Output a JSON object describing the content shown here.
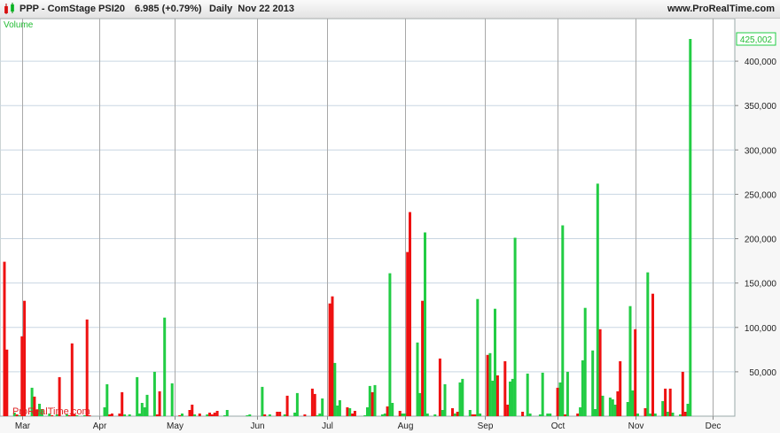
{
  "header": {
    "symbol": "PPP - ComStage PSI20",
    "price": "6.985 (+0.79%)",
    "period": "Daily",
    "date": "Nov 22 2013",
    "source": "www.ProRealTime.com"
  },
  "chart_data": {
    "type": "bar",
    "title": "Volume",
    "watermark": "ProRealTime.com",
    "last_value_label": "425,002",
    "x_start": "2013-02-21",
    "x_end": "2013-12-08",
    "month_labels": [
      {
        "label": "Mar",
        "date": "2013-03-01"
      },
      {
        "label": "Apr",
        "date": "2013-04-01"
      },
      {
        "label": "May",
        "date": "2013-05-01"
      },
      {
        "label": "Jun",
        "date": "2013-06-03"
      },
      {
        "label": "Jul",
        "date": "2013-07-01"
      },
      {
        "label": "Aug",
        "date": "2013-08-01"
      },
      {
        "label": "Sep",
        "date": "2013-09-02"
      },
      {
        "label": "Oct",
        "date": "2013-10-01"
      },
      {
        "label": "Nov",
        "date": "2013-11-01"
      },
      {
        "label": "Dec",
        "date": "2013-12-02"
      }
    ],
    "ylim": [
      0,
      440000
    ],
    "yticks": [
      50000,
      100000,
      150000,
      200000,
      250000,
      300000,
      350000,
      400000
    ],
    "ytick_labels": [
      "50,000",
      "100,000",
      "150,000",
      "200,000",
      "250,000",
      "300,000",
      "350,000",
      "400,000"
    ],
    "grid": true,
    "colors": {
      "up": "#22cc44",
      "down": "#ee1111",
      "grid": "#c9d6e2",
      "month_line": "#a8a8a8"
    },
    "bars": [
      {
        "x": "2013-02-21",
        "y": 174000,
        "c": "d"
      },
      {
        "x": "2013-02-22",
        "y": 75000,
        "c": "d"
      },
      {
        "x": "2013-02-25",
        "y": 4000,
        "c": "u"
      },
      {
        "x": "2013-02-26",
        "y": 2000,
        "c": "d"
      },
      {
        "x": "2013-02-27",
        "y": 1000,
        "c": "u"
      },
      {
        "x": "2013-02-28",
        "y": 90000,
        "c": "d"
      },
      {
        "x": "2013-03-01",
        "y": 130000,
        "c": "d"
      },
      {
        "x": "2013-03-04",
        "y": 32000,
        "c": "u"
      },
      {
        "x": "2013-03-05",
        "y": 22000,
        "c": "d"
      },
      {
        "x": "2013-03-06",
        "y": 7000,
        "c": "d"
      },
      {
        "x": "2013-03-07",
        "y": 14000,
        "c": "u"
      },
      {
        "x": "2013-03-08",
        "y": 8000,
        "c": "u"
      },
      {
        "x": "2013-03-11",
        "y": 3000,
        "c": "u"
      },
      {
        "x": "2013-03-12",
        "y": 1000,
        "c": "d"
      },
      {
        "x": "2013-03-14",
        "y": 2000,
        "c": "u"
      },
      {
        "x": "2013-03-15",
        "y": 44000,
        "c": "d"
      },
      {
        "x": "2013-03-18",
        "y": 2000,
        "c": "u"
      },
      {
        "x": "2013-03-19",
        "y": 1000,
        "c": "d"
      },
      {
        "x": "2013-03-20",
        "y": 82000,
        "c": "d"
      },
      {
        "x": "2013-03-21",
        "y": 2000,
        "c": "d"
      },
      {
        "x": "2013-03-22",
        "y": 1000,
        "c": "u"
      },
      {
        "x": "2013-03-25",
        "y": 1000,
        "c": "u"
      },
      {
        "x": "2013-03-26",
        "y": 109000,
        "c": "d"
      },
      {
        "x": "2013-03-27",
        "y": 1000,
        "c": "d"
      },
      {
        "x": "2013-04-02",
        "y": 10000,
        "c": "u"
      },
      {
        "x": "2013-04-03",
        "y": 36000,
        "c": "u"
      },
      {
        "x": "2013-04-04",
        "y": 2000,
        "c": "d"
      },
      {
        "x": "2013-04-05",
        "y": 3000,
        "c": "d"
      },
      {
        "x": "2013-04-08",
        "y": 3000,
        "c": "d"
      },
      {
        "x": "2013-04-09",
        "y": 27000,
        "c": "d"
      },
      {
        "x": "2013-04-10",
        "y": 2000,
        "c": "u"
      },
      {
        "x": "2013-04-12",
        "y": 2000,
        "c": "u"
      },
      {
        "x": "2013-04-15",
        "y": 44000,
        "c": "u"
      },
      {
        "x": "2013-04-16",
        "y": 3000,
        "c": "u"
      },
      {
        "x": "2013-04-17",
        "y": 15000,
        "c": "u"
      },
      {
        "x": "2013-04-18",
        "y": 10000,
        "c": "u"
      },
      {
        "x": "2013-04-19",
        "y": 24000,
        "c": "u"
      },
      {
        "x": "2013-04-22",
        "y": 50000,
        "c": "u"
      },
      {
        "x": "2013-04-23",
        "y": 2000,
        "c": "d"
      },
      {
        "x": "2013-04-24",
        "y": 28000,
        "c": "d"
      },
      {
        "x": "2013-04-26",
        "y": 111000,
        "c": "u"
      },
      {
        "x": "2013-04-29",
        "y": 37000,
        "c": "u"
      },
      {
        "x": "2013-05-02",
        "y": 1000,
        "c": "d"
      },
      {
        "x": "2013-05-03",
        "y": 3000,
        "c": "u"
      },
      {
        "x": "2013-05-06",
        "y": 7000,
        "c": "d"
      },
      {
        "x": "2013-05-07",
        "y": 13000,
        "c": "d"
      },
      {
        "x": "2013-05-08",
        "y": 2000,
        "c": "u"
      },
      {
        "x": "2013-05-10",
        "y": 3000,
        "c": "d"
      },
      {
        "x": "2013-05-13",
        "y": 2000,
        "c": "u"
      },
      {
        "x": "2013-05-14",
        "y": 4000,
        "c": "d"
      },
      {
        "x": "2013-05-15",
        "y": 2000,
        "c": "d"
      },
      {
        "x": "2013-05-16",
        "y": 4000,
        "c": "d"
      },
      {
        "x": "2013-05-17",
        "y": 6000,
        "c": "d"
      },
      {
        "x": "2013-05-20",
        "y": 1000,
        "c": "u"
      },
      {
        "x": "2013-05-21",
        "y": 7000,
        "c": "u"
      },
      {
        "x": "2013-05-29",
        "y": 1000,
        "c": "u"
      },
      {
        "x": "2013-05-30",
        "y": 2000,
        "c": "u"
      },
      {
        "x": "2013-06-04",
        "y": 33000,
        "c": "u"
      },
      {
        "x": "2013-06-05",
        "y": 2000,
        "c": "d"
      },
      {
        "x": "2013-06-07",
        "y": 2000,
        "c": "u"
      },
      {
        "x": "2013-06-10",
        "y": 5000,
        "c": "d"
      },
      {
        "x": "2013-06-11",
        "y": 5000,
        "c": "d"
      },
      {
        "x": "2013-06-13",
        "y": 2000,
        "c": "u"
      },
      {
        "x": "2013-06-14",
        "y": 23000,
        "c": "d"
      },
      {
        "x": "2013-06-17",
        "y": 4000,
        "c": "u"
      },
      {
        "x": "2013-06-18",
        "y": 26000,
        "c": "u"
      },
      {
        "x": "2013-06-21",
        "y": 2000,
        "c": "d"
      },
      {
        "x": "2013-06-24",
        "y": 31000,
        "c": "d"
      },
      {
        "x": "2013-06-25",
        "y": 25000,
        "c": "d"
      },
      {
        "x": "2013-06-26",
        "y": 1000,
        "c": "u"
      },
      {
        "x": "2013-06-27",
        "y": 3000,
        "c": "u"
      },
      {
        "x": "2013-06-28",
        "y": 20000,
        "c": "u"
      },
      {
        "x": "2013-07-01",
        "y": 127000,
        "c": "d"
      },
      {
        "x": "2013-07-02",
        "y": 135000,
        "c": "d"
      },
      {
        "x": "2013-07-03",
        "y": 60000,
        "c": "u"
      },
      {
        "x": "2013-07-04",
        "y": 12000,
        "c": "u"
      },
      {
        "x": "2013-07-05",
        "y": 18000,
        "c": "u"
      },
      {
        "x": "2013-07-08",
        "y": 10000,
        "c": "d"
      },
      {
        "x": "2013-07-09",
        "y": 9000,
        "c": "u"
      },
      {
        "x": "2013-07-10",
        "y": 3000,
        "c": "d"
      },
      {
        "x": "2013-07-11",
        "y": 6000,
        "c": "d"
      },
      {
        "x": "2013-07-15",
        "y": 1000,
        "c": "u"
      },
      {
        "x": "2013-07-16",
        "y": 10000,
        "c": "u"
      },
      {
        "x": "2013-07-17",
        "y": 34000,
        "c": "u"
      },
      {
        "x": "2013-07-18",
        "y": 27000,
        "c": "d"
      },
      {
        "x": "2013-07-19",
        "y": 35000,
        "c": "u"
      },
      {
        "x": "2013-07-22",
        "y": 2000,
        "c": "u"
      },
      {
        "x": "2013-07-23",
        "y": 3000,
        "c": "u"
      },
      {
        "x": "2013-07-24",
        "y": 11000,
        "c": "d"
      },
      {
        "x": "2013-07-25",
        "y": 161000,
        "c": "u"
      },
      {
        "x": "2013-07-26",
        "y": 15000,
        "c": "u"
      },
      {
        "x": "2013-07-29",
        "y": 6000,
        "c": "d"
      },
      {
        "x": "2013-07-30",
        "y": 3000,
        "c": "u"
      },
      {
        "x": "2013-07-31",
        "y": 3000,
        "c": "u"
      },
      {
        "x": "2013-08-01",
        "y": 185000,
        "c": "d"
      },
      {
        "x": "2013-08-02",
        "y": 230000,
        "c": "d"
      },
      {
        "x": "2013-08-05",
        "y": 83000,
        "c": "u"
      },
      {
        "x": "2013-08-06",
        "y": 26000,
        "c": "u"
      },
      {
        "x": "2013-08-07",
        "y": 130000,
        "c": "d"
      },
      {
        "x": "2013-08-08",
        "y": 207000,
        "c": "u"
      },
      {
        "x": "2013-08-09",
        "y": 3000,
        "c": "u"
      },
      {
        "x": "2013-08-12",
        "y": 2000,
        "c": "u"
      },
      {
        "x": "2013-08-14",
        "y": 65000,
        "c": "d"
      },
      {
        "x": "2013-08-15",
        "y": 7000,
        "c": "u"
      },
      {
        "x": "2013-08-16",
        "y": 36000,
        "c": "u"
      },
      {
        "x": "2013-08-19",
        "y": 9000,
        "c": "d"
      },
      {
        "x": "2013-08-20",
        "y": 3000,
        "c": "u"
      },
      {
        "x": "2013-08-21",
        "y": 5000,
        "c": "d"
      },
      {
        "x": "2013-08-22",
        "y": 38000,
        "c": "u"
      },
      {
        "x": "2013-08-23",
        "y": 42000,
        "c": "u"
      },
      {
        "x": "2013-08-26",
        "y": 7000,
        "c": "u"
      },
      {
        "x": "2013-08-27",
        "y": 2000,
        "c": "d"
      },
      {
        "x": "2013-08-28",
        "y": 2000,
        "c": "d"
      },
      {
        "x": "2013-08-29",
        "y": 132000,
        "c": "u"
      },
      {
        "x": "2013-08-30",
        "y": 3000,
        "c": "u"
      },
      {
        "x": "2013-09-02",
        "y": 69000,
        "c": "d"
      },
      {
        "x": "2013-09-03",
        "y": 71000,
        "c": "u"
      },
      {
        "x": "2013-09-04",
        "y": 40000,
        "c": "u"
      },
      {
        "x": "2013-09-05",
        "y": 121000,
        "c": "u"
      },
      {
        "x": "2013-09-06",
        "y": 46000,
        "c": "d"
      },
      {
        "x": "2013-09-09",
        "y": 62000,
        "c": "d"
      },
      {
        "x": "2013-09-10",
        "y": 13000,
        "c": "d"
      },
      {
        "x": "2013-09-11",
        "y": 39000,
        "c": "u"
      },
      {
        "x": "2013-09-12",
        "y": 42000,
        "c": "u"
      },
      {
        "x": "2013-09-13",
        "y": 201000,
        "c": "u"
      },
      {
        "x": "2013-09-16",
        "y": 5000,
        "c": "d"
      },
      {
        "x": "2013-09-18",
        "y": 48000,
        "c": "u"
      },
      {
        "x": "2013-09-19",
        "y": 3000,
        "c": "u"
      },
      {
        "x": "2013-09-23",
        "y": 2000,
        "c": "u"
      },
      {
        "x": "2013-09-24",
        "y": 49000,
        "c": "u"
      },
      {
        "x": "2013-09-26",
        "y": 3000,
        "c": "u"
      },
      {
        "x": "2013-09-27",
        "y": 3000,
        "c": "u"
      },
      {
        "x": "2013-09-30",
        "y": 32000,
        "c": "d"
      },
      {
        "x": "2013-10-01",
        "y": 38000,
        "c": "u"
      },
      {
        "x": "2013-10-02",
        "y": 215000,
        "c": "u"
      },
      {
        "x": "2013-10-03",
        "y": 2000,
        "c": "d"
      },
      {
        "x": "2013-10-04",
        "y": 50000,
        "c": "u"
      },
      {
        "x": "2013-10-08",
        "y": 3000,
        "c": "d"
      },
      {
        "x": "2013-10-09",
        "y": 10000,
        "c": "u"
      },
      {
        "x": "2013-10-10",
        "y": 63000,
        "c": "u"
      },
      {
        "x": "2013-10-11",
        "y": 122000,
        "c": "u"
      },
      {
        "x": "2013-10-14",
        "y": 74000,
        "c": "u"
      },
      {
        "x": "2013-10-15",
        "y": 8000,
        "c": "u"
      },
      {
        "x": "2013-10-16",
        "y": 262000,
        "c": "u"
      },
      {
        "x": "2013-10-17",
        "y": 98000,
        "c": "d"
      },
      {
        "x": "2013-10-18",
        "y": 23000,
        "c": "u"
      },
      {
        "x": "2013-10-21",
        "y": 21000,
        "c": "u"
      },
      {
        "x": "2013-10-22",
        "y": 19000,
        "c": "u"
      },
      {
        "x": "2013-10-23",
        "y": 13000,
        "c": "u"
      },
      {
        "x": "2013-10-24",
        "y": 28000,
        "c": "d"
      },
      {
        "x": "2013-10-25",
        "y": 62000,
        "c": "d"
      },
      {
        "x": "2013-10-28",
        "y": 16000,
        "c": "u"
      },
      {
        "x": "2013-10-29",
        "y": 124000,
        "c": "u"
      },
      {
        "x": "2013-10-30",
        "y": 29000,
        "c": "u"
      },
      {
        "x": "2013-10-31",
        "y": 98000,
        "c": "d"
      },
      {
        "x": "2013-11-01",
        "y": 3000,
        "c": "u"
      },
      {
        "x": "2013-11-04",
        "y": 9000,
        "c": "d"
      },
      {
        "x": "2013-11-05",
        "y": 162000,
        "c": "u"
      },
      {
        "x": "2013-11-06",
        "y": 3000,
        "c": "u"
      },
      {
        "x": "2013-11-07",
        "y": 138000,
        "c": "d"
      },
      {
        "x": "2013-11-08",
        "y": 3000,
        "c": "u"
      },
      {
        "x": "2013-11-11",
        "y": 17000,
        "c": "u"
      },
      {
        "x": "2013-11-12",
        "y": 31000,
        "c": "d"
      },
      {
        "x": "2013-11-13",
        "y": 5000,
        "c": "u"
      },
      {
        "x": "2013-11-14",
        "y": 31000,
        "c": "d"
      },
      {
        "x": "2013-11-15",
        "y": 4000,
        "c": "u"
      },
      {
        "x": "2013-11-18",
        "y": 2000,
        "c": "u"
      },
      {
        "x": "2013-11-19",
        "y": 50000,
        "c": "d"
      },
      {
        "x": "2013-11-20",
        "y": 5000,
        "c": "d"
      },
      {
        "x": "2013-11-21",
        "y": 14000,
        "c": "u"
      },
      {
        "x": "2013-11-22",
        "y": 425002,
        "c": "u"
      }
    ]
  }
}
